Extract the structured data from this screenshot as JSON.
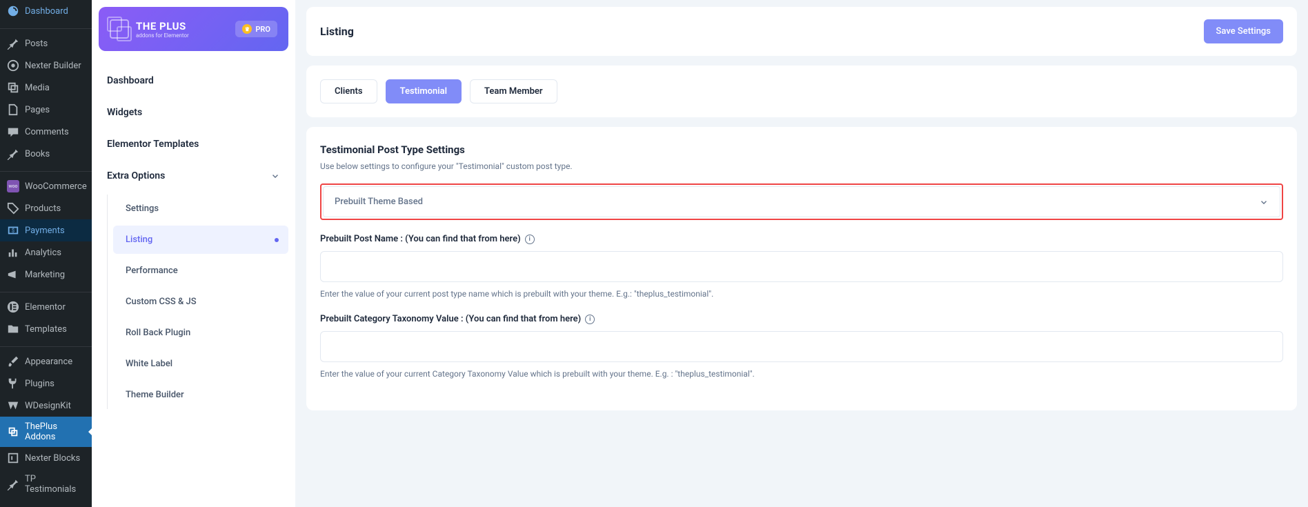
{
  "wp_menu": {
    "dashboard": "Dashboard",
    "posts": "Posts",
    "nexter_builder": "Nexter Builder",
    "media": "Media",
    "pages": "Pages",
    "comments": "Comments",
    "books": "Books",
    "woocommerce": "WooCommerce",
    "products": "Products",
    "payments": "Payments",
    "analytics": "Analytics",
    "marketing": "Marketing",
    "elementor": "Elementor",
    "templates": "Templates",
    "appearance": "Appearance",
    "plugins": "Plugins",
    "wdesignkit": "WDesignKit",
    "theplus_addons": "ThePlus Addons",
    "nexter_blocks": "Nexter Blocks",
    "tp_testimonials": "TP Testimonials"
  },
  "brand": {
    "title": "THE PLUS",
    "subtitle": "addons for Elementor",
    "badge": "PRO"
  },
  "panel": {
    "dashboard": "Dashboard",
    "widgets": "Widgets",
    "elementor_templates": "Elementor Templates",
    "extra_options": "Extra Options",
    "sub": {
      "settings": "Settings",
      "listing": "Listing",
      "performance": "Performance",
      "custom_css": "Custom CSS & JS",
      "rollback": "Roll Back Plugin",
      "white_label": "White Label",
      "theme_builder": "Theme Builder"
    }
  },
  "header": {
    "title": "Listing",
    "save": "Save Settings"
  },
  "tabs": {
    "clients": "Clients",
    "testimonial": "Testimonial",
    "team_member": "Team Member"
  },
  "form": {
    "section_title": "Testimonial Post Type Settings",
    "section_desc": "Use below settings to configure your \"Testimonial\" custom post type.",
    "select_value": "Prebuilt Theme Based",
    "post_name_label": "Prebuilt Post Name : (You can find that from here)",
    "post_name_value": "",
    "post_name_help": "Enter the value of your current post type name which is prebuilt with your theme. E.g.: \"theplus_testimonial\".",
    "taxonomy_label": "Prebuilt Category Taxonomy Value : (You can find that from here)",
    "taxonomy_value": "",
    "taxonomy_help": "Enter the value of your current Category Taxonomy Value which is prebuilt with your theme. E.g. : \"theplus_testimonial\"."
  }
}
